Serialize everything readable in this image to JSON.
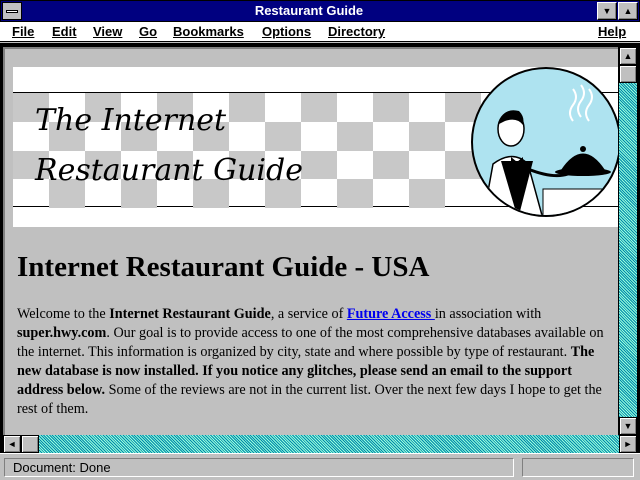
{
  "window": {
    "title": "Restaurant Guide"
  },
  "menubar": {
    "items": [
      {
        "label": "File"
      },
      {
        "label": "Edit"
      },
      {
        "label": "View"
      },
      {
        "label": "Go"
      },
      {
        "label": "Bookmarks"
      },
      {
        "label": "Options"
      },
      {
        "label": "Directory"
      },
      {
        "label": "Help"
      }
    ]
  },
  "banner": {
    "logo_line1": "The Internet",
    "logo_line2": "Restaurant Guide",
    "circle_color": "#aee3f0"
  },
  "main": {
    "heading": "Internet Restaurant Guide - USA",
    "para": {
      "p1": "Welcome to the ",
      "b1": "Internet Restaurant Guide",
      "p2": ", a service of ",
      "link": "Future Access ",
      "p3": "in association with ",
      "b2": "super.hwy.com",
      "p4": ". Our goal is to provide access to one of the most comprehensive databases available on the internet. This information is organized by city, state and where possible by type of restaurant. ",
      "b3": "The new database is now installed. If you notice any glitches, please send an email to the support address below.",
      "p5": " Some of the reviews are not in the current list. Over the next few days I hope to get the rest of them."
    }
  },
  "status": {
    "text": "Document: Done"
  },
  "colors": {
    "titlebar": "#000080",
    "link": "#0000ee",
    "scroll_track": "#00b0b0"
  }
}
